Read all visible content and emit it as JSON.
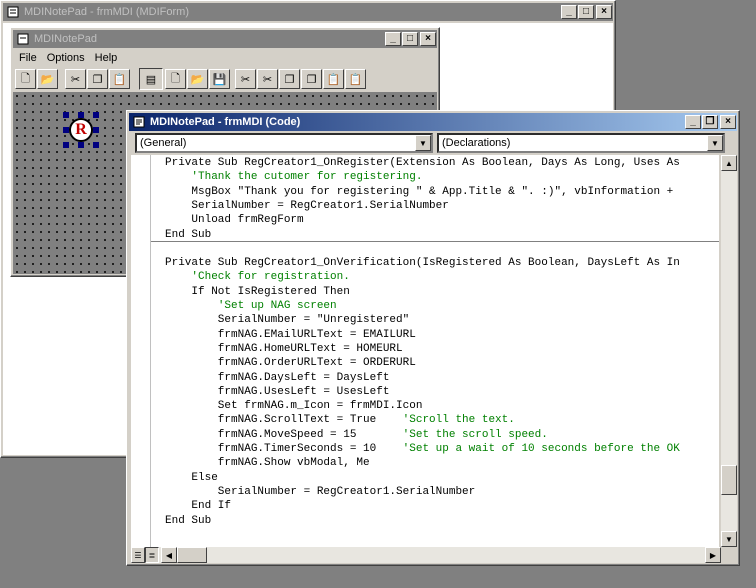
{
  "mdi_window": {
    "title": "MDINotePad - frmMDI (MDIForm)"
  },
  "form_window": {
    "title": "MDINotePad",
    "menu": [
      {
        "label": "File"
      },
      {
        "label": "Options"
      },
      {
        "label": "Help"
      }
    ],
    "control_icon_letter": "R"
  },
  "code_window": {
    "title": "MDINotePad - frmMDI (Code)",
    "object_combo": "(General)",
    "procedure_combo": "(Declarations)",
    "lines": [
      {
        "code": "Private Sub RegCreator1_OnRegister(Extension As Boolean, Days As Long, Uses As",
        "comment": ""
      },
      {
        "code": "    ",
        "comment": "'Thank the cutomer for registering."
      },
      {
        "code": "    MsgBox \"Thank you for registering \" & App.Title & \". :)\", vbInformation +",
        "comment": ""
      },
      {
        "code": "    SerialNumber = RegCreator1.SerialNumber",
        "comment": ""
      },
      {
        "code": "    Unload frmRegForm",
        "comment": ""
      },
      {
        "code": "End Sub",
        "comment": ""
      },
      {
        "code": "",
        "comment": ""
      },
      {
        "code": "Private Sub RegCreator1_OnVerification(IsRegistered As Boolean, DaysLeft As In",
        "comment": ""
      },
      {
        "code": "    ",
        "comment": "'Check for registration."
      },
      {
        "code": "    If Not IsRegistered Then",
        "comment": ""
      },
      {
        "code": "        ",
        "comment": "'Set up NAG screen"
      },
      {
        "code": "        SerialNumber = \"Unregistered\"",
        "comment": ""
      },
      {
        "code": "        frmNAG.EMailURLText = EMAILURL",
        "comment": ""
      },
      {
        "code": "        frmNAG.HomeURLText = HOMEURL",
        "comment": ""
      },
      {
        "code": "        frmNAG.OrderURLText = ORDERURL",
        "comment": ""
      },
      {
        "code": "        frmNAG.DaysLeft = DaysLeft",
        "comment": ""
      },
      {
        "code": "        frmNAG.UsesLeft = UsesLeft",
        "comment": ""
      },
      {
        "code": "        Set frmNAG.m_Icon = frmMDI.Icon",
        "comment": ""
      },
      {
        "code": "        frmNAG.ScrollText = True    ",
        "comment": "'Scroll the text."
      },
      {
        "code": "        frmNAG.MoveSpeed = 15       ",
        "comment": "'Set the scroll speed."
      },
      {
        "code": "        frmNAG.TimerSeconds = 10    ",
        "comment": "'Set up a wait of 10 seconds before the OK"
      },
      {
        "code": "        frmNAG.Show vbModal, Me",
        "comment": ""
      },
      {
        "code": "    Else",
        "comment": ""
      },
      {
        "code": "        SerialNumber = RegCreator1.SerialNumber",
        "comment": ""
      },
      {
        "code": "    End If",
        "comment": ""
      },
      {
        "code": "End Sub",
        "comment": ""
      }
    ]
  },
  "icons": {
    "minimize": "minimize-icon",
    "maximize": "maximize-icon",
    "close": "close-icon"
  },
  "colors": {
    "active_title": "#0a246a",
    "inactive_title": "#808080",
    "comment": "#008000",
    "face": "#d4d0c8"
  }
}
